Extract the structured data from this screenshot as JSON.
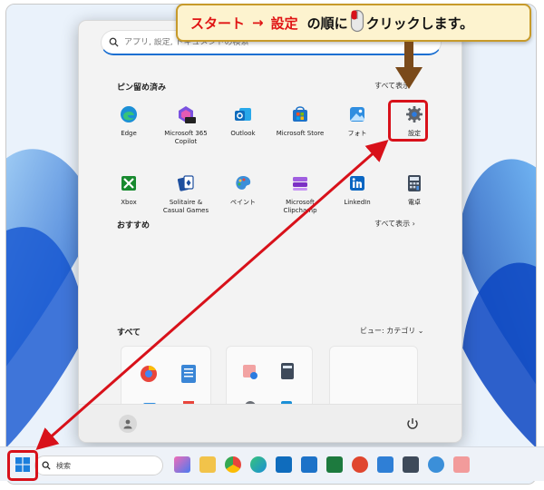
{
  "callout": {
    "step1": "スタート",
    "arrow": "→",
    "step2": "設定",
    "middle": "の順に",
    "end": "クリックします。"
  },
  "start_menu": {
    "search_placeholder": "アプリ, 設定, ドキュメントの検索",
    "pinned_title": "ピン留め済み",
    "pinned_all": "すべて表示",
    "pinned_apps": [
      {
        "label": "Edge",
        "icon": "edge-icon",
        "color": "#1b8fd6"
      },
      {
        "label": "Microsoft 365\nCopilot",
        "icon": "m365-copilot-icon",
        "color": "#6d4ed8"
      },
      {
        "label": "Outlook",
        "icon": "outlook-icon",
        "color": "#0f6cbd"
      },
      {
        "label": "Microsoft Store",
        "icon": "store-icon",
        "color": "#1d72c8"
      },
      {
        "label": "フォト",
        "icon": "photos-icon",
        "color": "#2f8ee0"
      },
      {
        "label": "設定",
        "icon": "gear-icon",
        "color": "#6b6f76"
      },
      {
        "label": "Xbox",
        "icon": "xbox-icon",
        "color": "#188a2f"
      },
      {
        "label": "Solitaire &\nCasual Games",
        "icon": "solitaire-icon",
        "color": "#1e4f9e"
      },
      {
        "label": "ペイント",
        "icon": "paint-icon",
        "color": "#3b8fd9"
      },
      {
        "label": "Microsoft\nClipchamp",
        "icon": "clipchamp-icon",
        "color": "#8a3ccf"
      },
      {
        "label": "LinkedIn",
        "icon": "linkedin-icon",
        "color": "#0a66c2"
      },
      {
        "label": "電卓",
        "icon": "calculator-icon",
        "color": "#3e4a5a"
      }
    ],
    "recommended_title": "おすすめ",
    "recommended_all": "すべて表示",
    "all_title": "すべて",
    "view_label": "ビュー: カテゴリ"
  },
  "taskbar": {
    "search_label": "検索"
  }
}
